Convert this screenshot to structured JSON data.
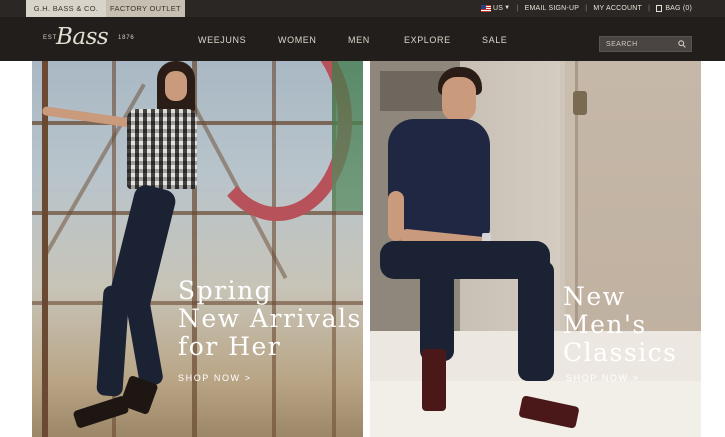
{
  "utility": {
    "tab_main": "G.H. BASS & CO.",
    "tab_outlet": "FACTORY OUTLET",
    "country": "US",
    "email_signup": "EMAIL SIGN-UP",
    "my_account": "MY ACCOUNT",
    "bag": "BAG (0)"
  },
  "logo": {
    "est": "EST",
    "word": "Bass",
    "year": "1876"
  },
  "nav": {
    "items": [
      "WEEJUNS",
      "WOMEN",
      "MEN",
      "EXPLORE",
      "SALE"
    ]
  },
  "search": {
    "placeholder": "SEARCH"
  },
  "hero_left": {
    "headline": [
      "Spring",
      "New Arrivals",
      "for Her"
    ],
    "cta": "SHOP NOW  >"
  },
  "hero_right": {
    "headline": [
      "New",
      "Men's",
      "Classics"
    ],
    "cta": "SHOP NOW  >"
  },
  "colors": {
    "topbar": "#2b2725",
    "navbar": "#221e1c",
    "tab_active": "#d9d4c9",
    "tab_outlet": "#c7c0b2",
    "nav_text": "#ddd7cc"
  }
}
